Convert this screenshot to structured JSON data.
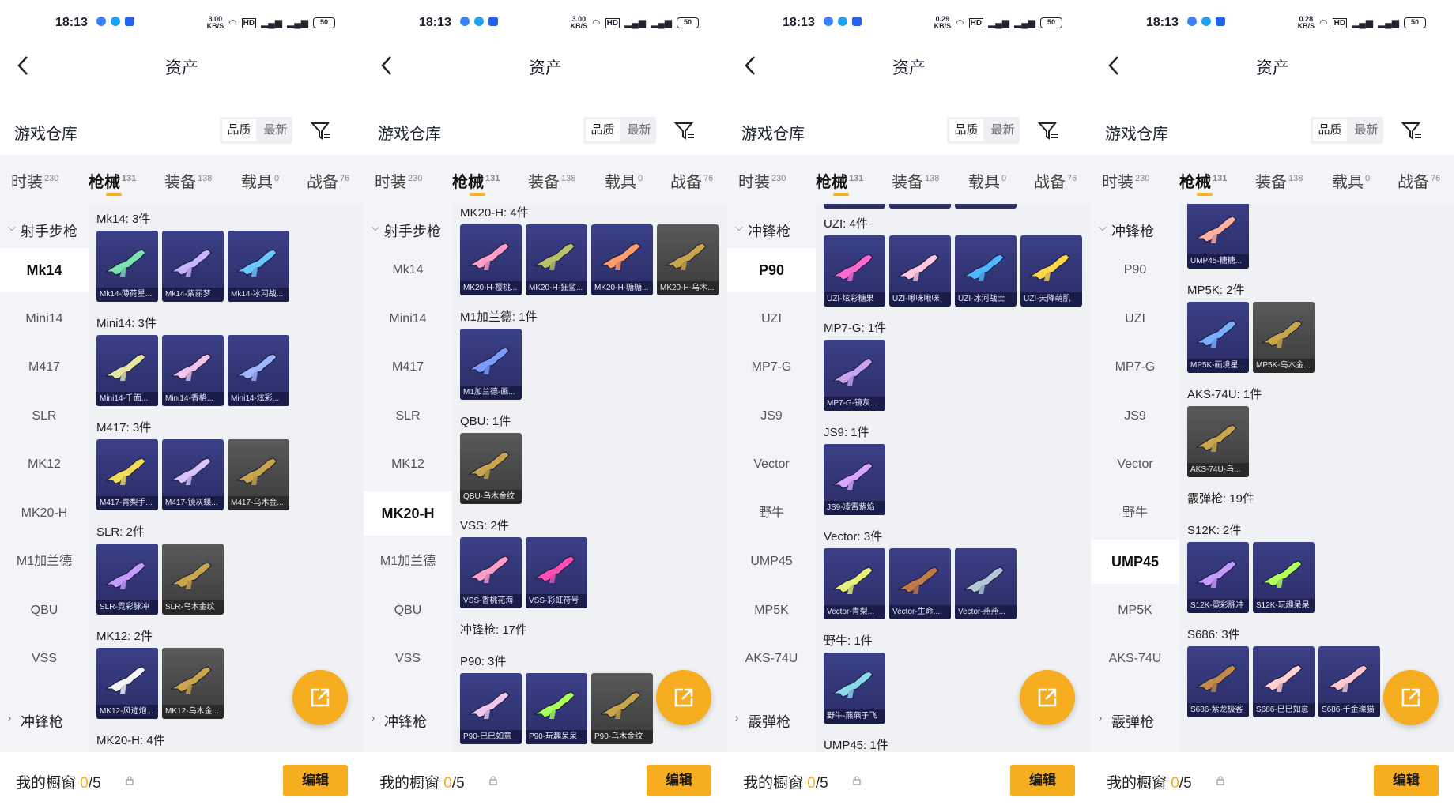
{
  "panels": [
    {
      "status": {
        "time": "18:13",
        "speed": "3.00\nKB/S",
        "battery": "50"
      },
      "header": {
        "title": "资产"
      },
      "warehouse": {
        "title": "游戏仓库",
        "sort_quality": "品质",
        "sort_newest": "最新"
      },
      "tabs": [
        {
          "label": "时装",
          "count": "230"
        },
        {
          "label": "枪械",
          "count": "131"
        },
        {
          "label": "装备",
          "count": "138"
        },
        {
          "label": "载具",
          "count": "0"
        },
        {
          "label": "战备",
          "count": "76"
        }
      ],
      "sidebar_group": "射手步枪",
      "sidebar_items": [
        "Mk14",
        "Mini14",
        "M417",
        "SLR",
        "MK12",
        "MK20-H",
        "M1加兰德",
        "QBU",
        "VSS"
      ],
      "sidebar_footer_group": "冲锋枪",
      "groups": [
        {
          "title": "Mk14: 3件",
          "items": [
            "Mk14-薄荷星...",
            "Mk14-紫丽梦",
            "Mk14-冰河战..."
          ]
        },
        {
          "title": "Mini14: 3件",
          "items": [
            "Mini14-千面...",
            "Mini14-香格...",
            "Mini14-炫彩..."
          ]
        },
        {
          "title": "M417: 3件",
          "items": [
            "M417-青梨手...",
            "M417-镜灰蝶...",
            "M417-乌木金..."
          ]
        },
        {
          "title": "SLR: 2件",
          "items": [
            "SLR-霓彩脉冲",
            "SLR-乌木金纹"
          ]
        },
        {
          "title": "MK12: 2件",
          "items": [
            "MK12-风迹炮...",
            "MK12-乌木金..."
          ]
        },
        {
          "title": "MK20-H: 4件",
          "items": []
        }
      ],
      "footer": {
        "label": "我的橱窗",
        "count_current": "0",
        "count_total": "/5",
        "edit": "编辑"
      }
    },
    {
      "status": {
        "time": "18:13",
        "speed": "3.00\nKB/S",
        "battery": "50"
      },
      "header": {
        "title": "资产"
      },
      "warehouse": {
        "title": "游戏仓库",
        "sort_quality": "品质",
        "sort_newest": "最新"
      },
      "tabs": [
        {
          "label": "时装",
          "count": "230"
        },
        {
          "label": "枪械",
          "count": "131"
        },
        {
          "label": "装备",
          "count": "138"
        },
        {
          "label": "载具",
          "count": "0"
        },
        {
          "label": "战备",
          "count": "76"
        }
      ],
      "sidebar_group": "射手步枪",
      "sidebar_items": [
        "Mk14",
        "Mini14",
        "M417",
        "SLR",
        "MK12",
        "MK20-H",
        "M1加兰德",
        "QBU",
        "VSS"
      ],
      "sidebar_footer_group": "冲锋枪",
      "groups": [
        {
          "title": "MK20-H: 4件",
          "items": [
            "MK20-H-樱桃...",
            "MK20-H-狂鲨...",
            "MK20-H-糖糖...",
            "MK20-H-乌木..."
          ]
        },
        {
          "title": "M1加兰德: 1件",
          "items": [
            "M1加兰德-画..."
          ]
        },
        {
          "title": "QBU: 1件",
          "items": [
            "QBU-乌木金纹"
          ]
        },
        {
          "title": "VSS: 2件",
          "items": [
            "VSS-香桃花海",
            "VSS-彩虹符号"
          ]
        },
        {
          "title": "冲锋枪: 17件",
          "items": []
        },
        {
          "title": "P90: 3件",
          "items": [
            "P90-巳巳如意",
            "P90-玩趣呆呆",
            "P90-乌木金纹"
          ]
        }
      ],
      "footer": {
        "label": "我的橱窗",
        "count_current": "0",
        "count_total": "/5",
        "edit": "编辑"
      }
    },
    {
      "status": {
        "time": "18:13",
        "speed": "0.29\nKB/S",
        "battery": "50"
      },
      "header": {
        "title": "资产"
      },
      "warehouse": {
        "title": "游戏仓库",
        "sort_quality": "品质",
        "sort_newest": "最新"
      },
      "tabs": [
        {
          "label": "时装",
          "count": "230"
        },
        {
          "label": "枪械",
          "count": "131"
        },
        {
          "label": "装备",
          "count": "138"
        },
        {
          "label": "载具",
          "count": "0"
        },
        {
          "label": "战备",
          "count": "76"
        }
      ],
      "sidebar_group": "冲锋枪",
      "sidebar_items": [
        "P90",
        "UZI",
        "MP7-G",
        "JS9",
        "Vector",
        "野牛",
        "UMP45",
        "MP5K",
        "AKS-74U"
      ],
      "sidebar_footer_group": "霰弹枪",
      "groups": [
        {
          "title": "UZI: 4件",
          "items": [
            "UZI-炫彩糖果",
            "UZI-啾咪啾咪",
            "UZI-冰河战士",
            "UZI-天降萌肌"
          ]
        },
        {
          "title": "MP7-G: 1件",
          "items": [
            "MP7-G-镜灰..."
          ]
        },
        {
          "title": "JS9: 1件",
          "items": [
            "JS9-凌霄紫焰"
          ]
        },
        {
          "title": "Vector: 3件",
          "items": [
            "Vector-青梨...",
            "Vector-生命...",
            "Vector-燕燕..."
          ]
        },
        {
          "title": "野牛: 1件",
          "items": [
            "野牛-燕燕子飞"
          ]
        },
        {
          "title": "UMP45: 1件",
          "items": []
        }
      ],
      "footer": {
        "label": "我的橱窗",
        "count_current": "0",
        "count_total": "/5",
        "edit": "编辑"
      }
    },
    {
      "status": {
        "time": "18:13",
        "speed": "0.28\nKB/S",
        "battery": "50"
      },
      "header": {
        "title": "资产"
      },
      "warehouse": {
        "title": "游戏仓库",
        "sort_quality": "品质",
        "sort_newest": "最新"
      },
      "tabs": [
        {
          "label": "时装",
          "count": "230"
        },
        {
          "label": "枪械",
          "count": "131"
        },
        {
          "label": "装备",
          "count": "138"
        },
        {
          "label": "载具",
          "count": "0"
        },
        {
          "label": "战备",
          "count": "76"
        }
      ],
      "sidebar_group": "冲锋枪",
      "sidebar_items": [
        "P90",
        "UZI",
        "MP7-G",
        "JS9",
        "Vector",
        "野牛",
        "UMP45",
        "MP5K",
        "AKS-74U"
      ],
      "sidebar_footer_group": "霰弹枪",
      "groups": [
        {
          "title": "",
          "items": [
            "UMP45-糖糖..."
          ]
        },
        {
          "title": "MP5K: 2件",
          "items": [
            "MP5K-画境星...",
            "MP5K-乌木金..."
          ]
        },
        {
          "title": "AKS-74U: 1件",
          "items": [
            "AKS-74U-乌..."
          ]
        },
        {
          "title": "霰弹枪: 19件",
          "items": []
        },
        {
          "title": "S12K: 2件",
          "items": [
            "S12K-霓彩脉冲",
            "S12K-玩趣呆呆"
          ]
        },
        {
          "title": "S686: 3件",
          "items": [
            "S686-紫龙极客",
            "S686-巳巳如意",
            "S686-千金璨猫"
          ]
        }
      ],
      "footer": {
        "label": "我的橱窗",
        "count_current": "0",
        "count_total": "/5",
        "edit": "编辑"
      }
    }
  ]
}
